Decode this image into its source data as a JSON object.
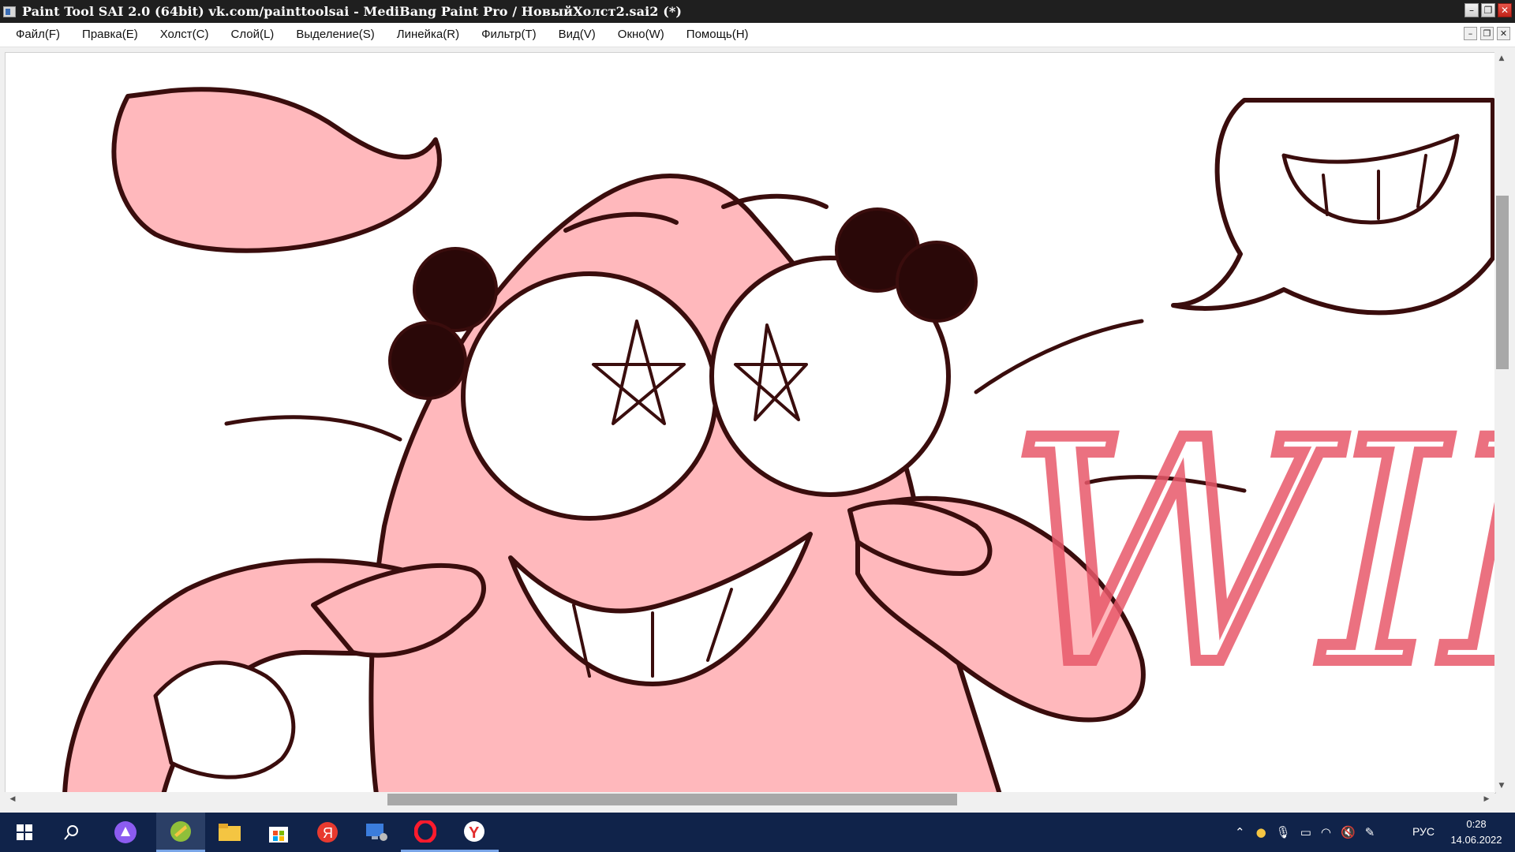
{
  "window": {
    "title": "Paint Tool SAI 2.0 (64bit) vk.com/painttoolsai - MediBang Paint Pro / НовыйХолст2.sai2 (*)",
    "buttons": {
      "minimize": "–",
      "restore": "❐",
      "close": "✕"
    }
  },
  "menu": {
    "items": [
      "Файл(F)",
      "Правка(E)",
      "Холст(C)",
      "Слой(L)",
      "Выделение(S)",
      "Линейка(R)",
      "Фильтр(T)",
      "Вид(V)",
      "Окно(W)",
      "Помощь(H)"
    ],
    "mdi_buttons": {
      "minimize": "–",
      "restore": "❐",
      "close": "✕"
    }
  },
  "canvas": {
    "watermark_text": "WIP",
    "colors": {
      "skin": "#ffb8bc",
      "outline": "#3a0d0d",
      "watermark": "#e8586a",
      "paper": "#ffffff"
    }
  },
  "scrollbars": {
    "vertical": {
      "up": "▲",
      "down": "▼",
      "position": 0.2
    },
    "horizontal": {
      "left": "◀",
      "right": "▶",
      "position": 0.38
    }
  },
  "taskbar": {
    "apps": [
      "start-icon",
      "search-icon",
      "alice-assistant-icon",
      "paint-tool-sai-icon",
      "file-explorer-icon",
      "microsoft-store-icon",
      "yandex-browser-icon",
      "desktop-app-icon",
      "opera-icon",
      "yandex-icon"
    ],
    "tray": {
      "language": "РУС",
      "time": "0:28",
      "date": "14.06.2022"
    },
    "colors": {
      "background": "#10234a",
      "active": "#2b3f66"
    }
  }
}
